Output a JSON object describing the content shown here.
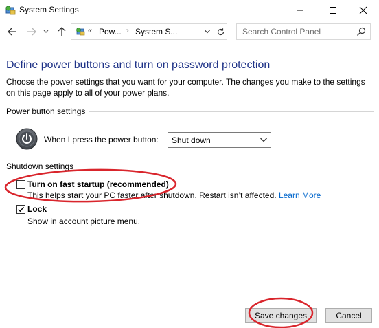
{
  "window": {
    "title": "System Settings",
    "icon": "control-panel-icon"
  },
  "address": {
    "overflow": "«",
    "segments": [
      "Pow...",
      "System S..."
    ]
  },
  "search": {
    "placeholder": "Search Control Panel"
  },
  "page": {
    "heading": "Define power buttons and turn on password protection",
    "description": "Choose the power settings that you want for your computer. The changes you make to the settings on this page apply to all of your power plans."
  },
  "power_buttons": {
    "group_title": "Power button settings",
    "label": "When I press the power button:",
    "selected": "Shut down"
  },
  "shutdown": {
    "group_title": "Shutdown settings",
    "items": [
      {
        "label": "Turn on fast startup (recommended)",
        "checked": false,
        "description": "This helps start your PC faster after shutdown. Restart isn’t affected.",
        "link": "Learn More"
      },
      {
        "label": "Lock",
        "checked": true,
        "description": "Show in account picture menu."
      }
    ]
  },
  "buttons": {
    "save": "Save changes",
    "cancel": "Cancel"
  },
  "annotation_color": "#d9252c"
}
